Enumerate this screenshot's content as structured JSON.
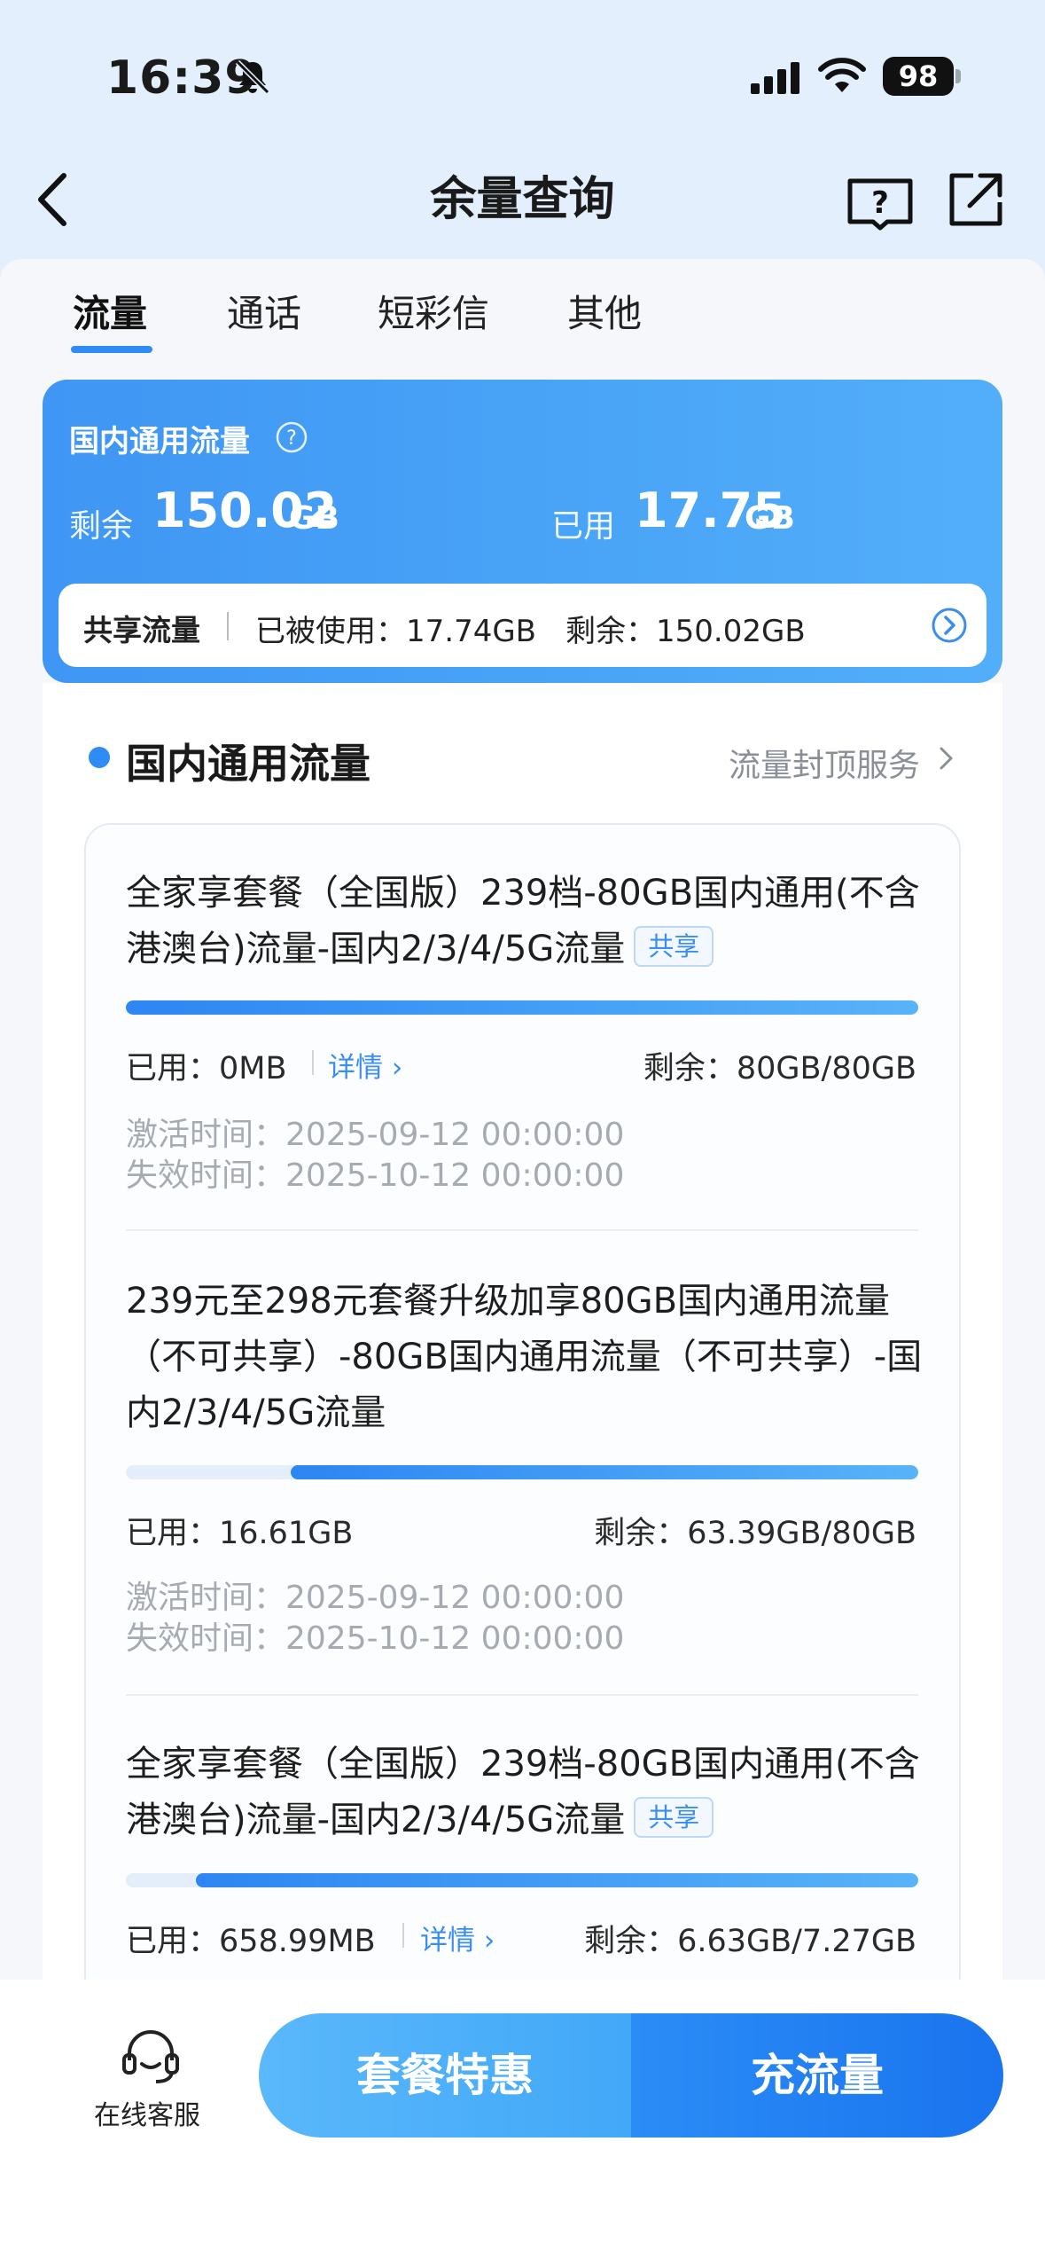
{
  "status_bar": {
    "time": "16:39",
    "battery": "98"
  },
  "nav": {
    "title": "余量查询"
  },
  "tabs": [
    {
      "label": "流量",
      "active": true
    },
    {
      "label": "通话",
      "active": false
    },
    {
      "label": "短彩信",
      "active": false
    },
    {
      "label": "其他",
      "active": false
    }
  ],
  "summary": {
    "title": "国内通用流量",
    "remain_label": "剩余",
    "remain_value": "150.02",
    "remain_unit": "GB",
    "used_label": "已用",
    "used_value": "17.75",
    "used_unit": "GB",
    "share": {
      "label": "共享流量",
      "used": "已被使用：17.74GB",
      "remain": "剩余：150.02GB"
    }
  },
  "section": {
    "title": "国内通用流量",
    "link": "流量封顶服务"
  },
  "packages": [
    {
      "title": "全家享套餐（全国版）239档-80GB国内通用(不含港澳台)流量-国内2/3/4/5G流量",
      "tag": "共享",
      "used": "已用：0MB",
      "detail": "详情",
      "remain": "剩余：80GB/80GB",
      "used_fraction": 0.0,
      "activate": "激活时间：2025-09-12 00:00:00",
      "expire": "失效时间：2025-10-12 00:00:00"
    },
    {
      "title": "239元至298元套餐升级加享80GB国内通用流量（不可共享）-80GB国内通用流量（不可共享）-国内2/3/4/5G流量",
      "tag": "",
      "used": "已用：16.61GB",
      "detail": "",
      "remain": "剩余：63.39GB/80GB",
      "used_fraction": 0.2076,
      "activate": "激活时间：2025-09-12 00:00:00",
      "expire": "失效时间：2025-10-12 00:00:00"
    },
    {
      "title": "全家享套餐（全国版）239档-80GB国内通用(不含港澳台)流量-国内2/3/4/5G流量",
      "tag": "共享",
      "used": "已用：658.99MB",
      "detail": "详情",
      "remain": "剩余：6.63GB/7.27GB",
      "used_fraction": 0.0885,
      "activate": "",
      "expire": ""
    }
  ],
  "bottom": {
    "service_label": "在线客服",
    "btn_left": "套餐特惠",
    "btn_right": "充流量"
  },
  "colors": {
    "accent": "#2f8cf5",
    "header_bg": "#e3effc"
  },
  "icons": [
    "bell-slash-icon",
    "signal-icon",
    "wifi-icon",
    "back-chevron-icon",
    "help-book-icon",
    "share-icon",
    "question-circle-icon",
    "arrow-circle-icon",
    "chevron-right-icon",
    "headset-icon"
  ]
}
